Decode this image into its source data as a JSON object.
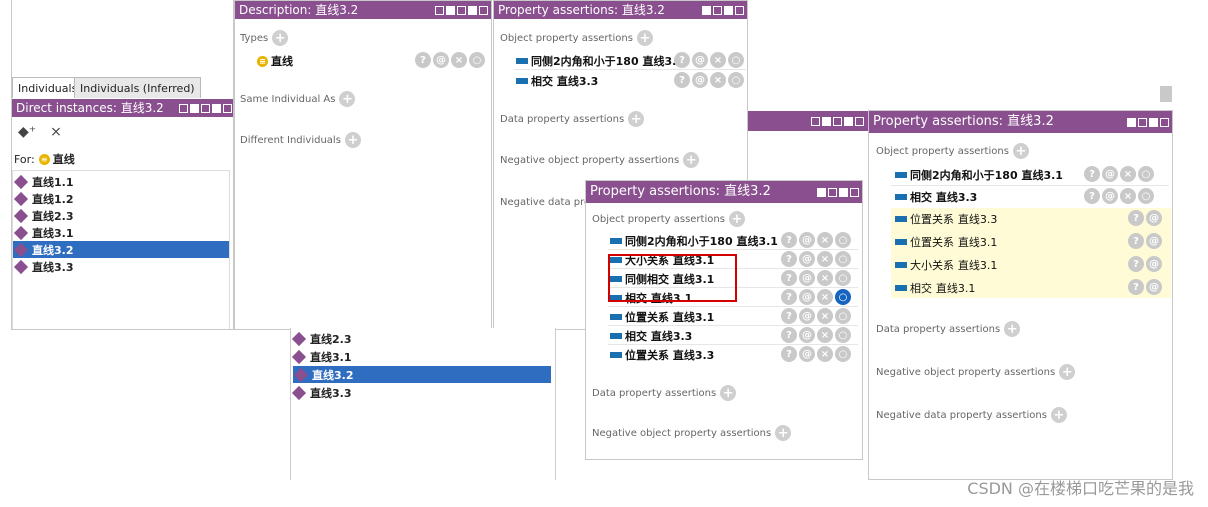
{
  "left": {
    "tabs": [
      "Individuals",
      "Individuals (Inferred)"
    ],
    "header": "Direct instances: 直线3.2",
    "for_label": "For:",
    "for_value": "直线",
    "items": [
      "直线1.1",
      "直线1.2",
      "直线2.3",
      "直线3.1",
      "直线3.2",
      "直线3.3"
    ],
    "selected": "直线3.2"
  },
  "desc": {
    "header": "Description: 直线3.2",
    "types_label": "Types",
    "type_value": "直线",
    "same_label": "Same Individual As",
    "diff_label": "Different Individuals"
  },
  "pa1": {
    "header": "Property assertions: 直线3.2",
    "obj_label": "Object property assertions",
    "rows": [
      {
        "prop": "同侧2内角和小于180",
        "val": "直线3.1"
      },
      {
        "prop": "相交",
        "val": "直线3.3"
      }
    ],
    "data_label": "Data property assertions",
    "neg_obj_label": "Negative object property assertions",
    "neg_data_label": "Negative data prope"
  },
  "bottom_list": {
    "items": [
      "直线2.3",
      "直线3.1",
      "直线3.2",
      "直线3.3"
    ],
    "selected": "直线3.2"
  },
  "pa2": {
    "header": "Property assertions: 直线3.2",
    "obj_label": "Object property assertions",
    "rows": [
      {
        "prop": "同侧2内角和小于180",
        "val": "直线3.1"
      },
      {
        "prop": "大小关系",
        "val": "直线3.1"
      },
      {
        "prop": "同侧相交",
        "val": "直线3.1"
      },
      {
        "prop": "相交",
        "val": "直线3.1"
      },
      {
        "prop": "位置关系",
        "val": "直线3.1"
      },
      {
        "prop": "相交",
        "val": "直线3.3"
      },
      {
        "prop": "位置关系",
        "val": "直线3.3"
      }
    ],
    "data_label": "Data property assertions",
    "neg_obj_label": "Negative object property assertions"
  },
  "pa3": {
    "header": "Property assertions: 直线3.2",
    "obj_label": "Object property assertions",
    "rows": [
      {
        "prop": "同侧2内角和小于180",
        "val": "直线3.1"
      },
      {
        "prop": "相交",
        "val": "直线3.3"
      },
      {
        "prop": "位置关系",
        "val": "直线3.3"
      },
      {
        "prop": "位置关系",
        "val": "直线3.1"
      },
      {
        "prop": "大小关系",
        "val": "直线3.1"
      },
      {
        "prop": "相交",
        "val": "直线3.1"
      }
    ],
    "data_label": "Data property assertions",
    "neg_obj_label": "Negative object property assertions",
    "neg_data_label": "Negative data property assertions"
  },
  "icons": {
    "help": "?",
    "annotate": "@",
    "delete": "×",
    "edit": "○"
  },
  "watermark": "CSDN @在楼梯口吃芒果的是我",
  "colors": {
    "header": "#8a4f8e",
    "selection": "#2f6dc0",
    "inferred_bg": "#fffbd6",
    "property_bar": "#1a6fb0"
  }
}
